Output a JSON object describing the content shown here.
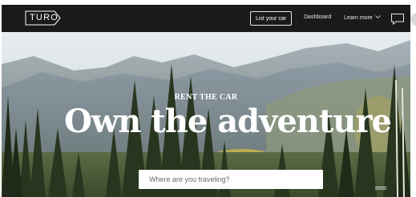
{
  "brand": {
    "logo_text": "TURO"
  },
  "nav": {
    "list_car_label": "List your car",
    "dashboard_label": "Dashboard",
    "learn_more_label": "Learn more"
  },
  "hero": {
    "eyebrow": "RENT THE CAR",
    "headline": "Own the adventure",
    "search_placeholder": "Where are you traveling?"
  },
  "colors": {
    "navbar": "#1a1a1a",
    "hero_text": "#ffffff",
    "search_bg": "#ffffff"
  }
}
